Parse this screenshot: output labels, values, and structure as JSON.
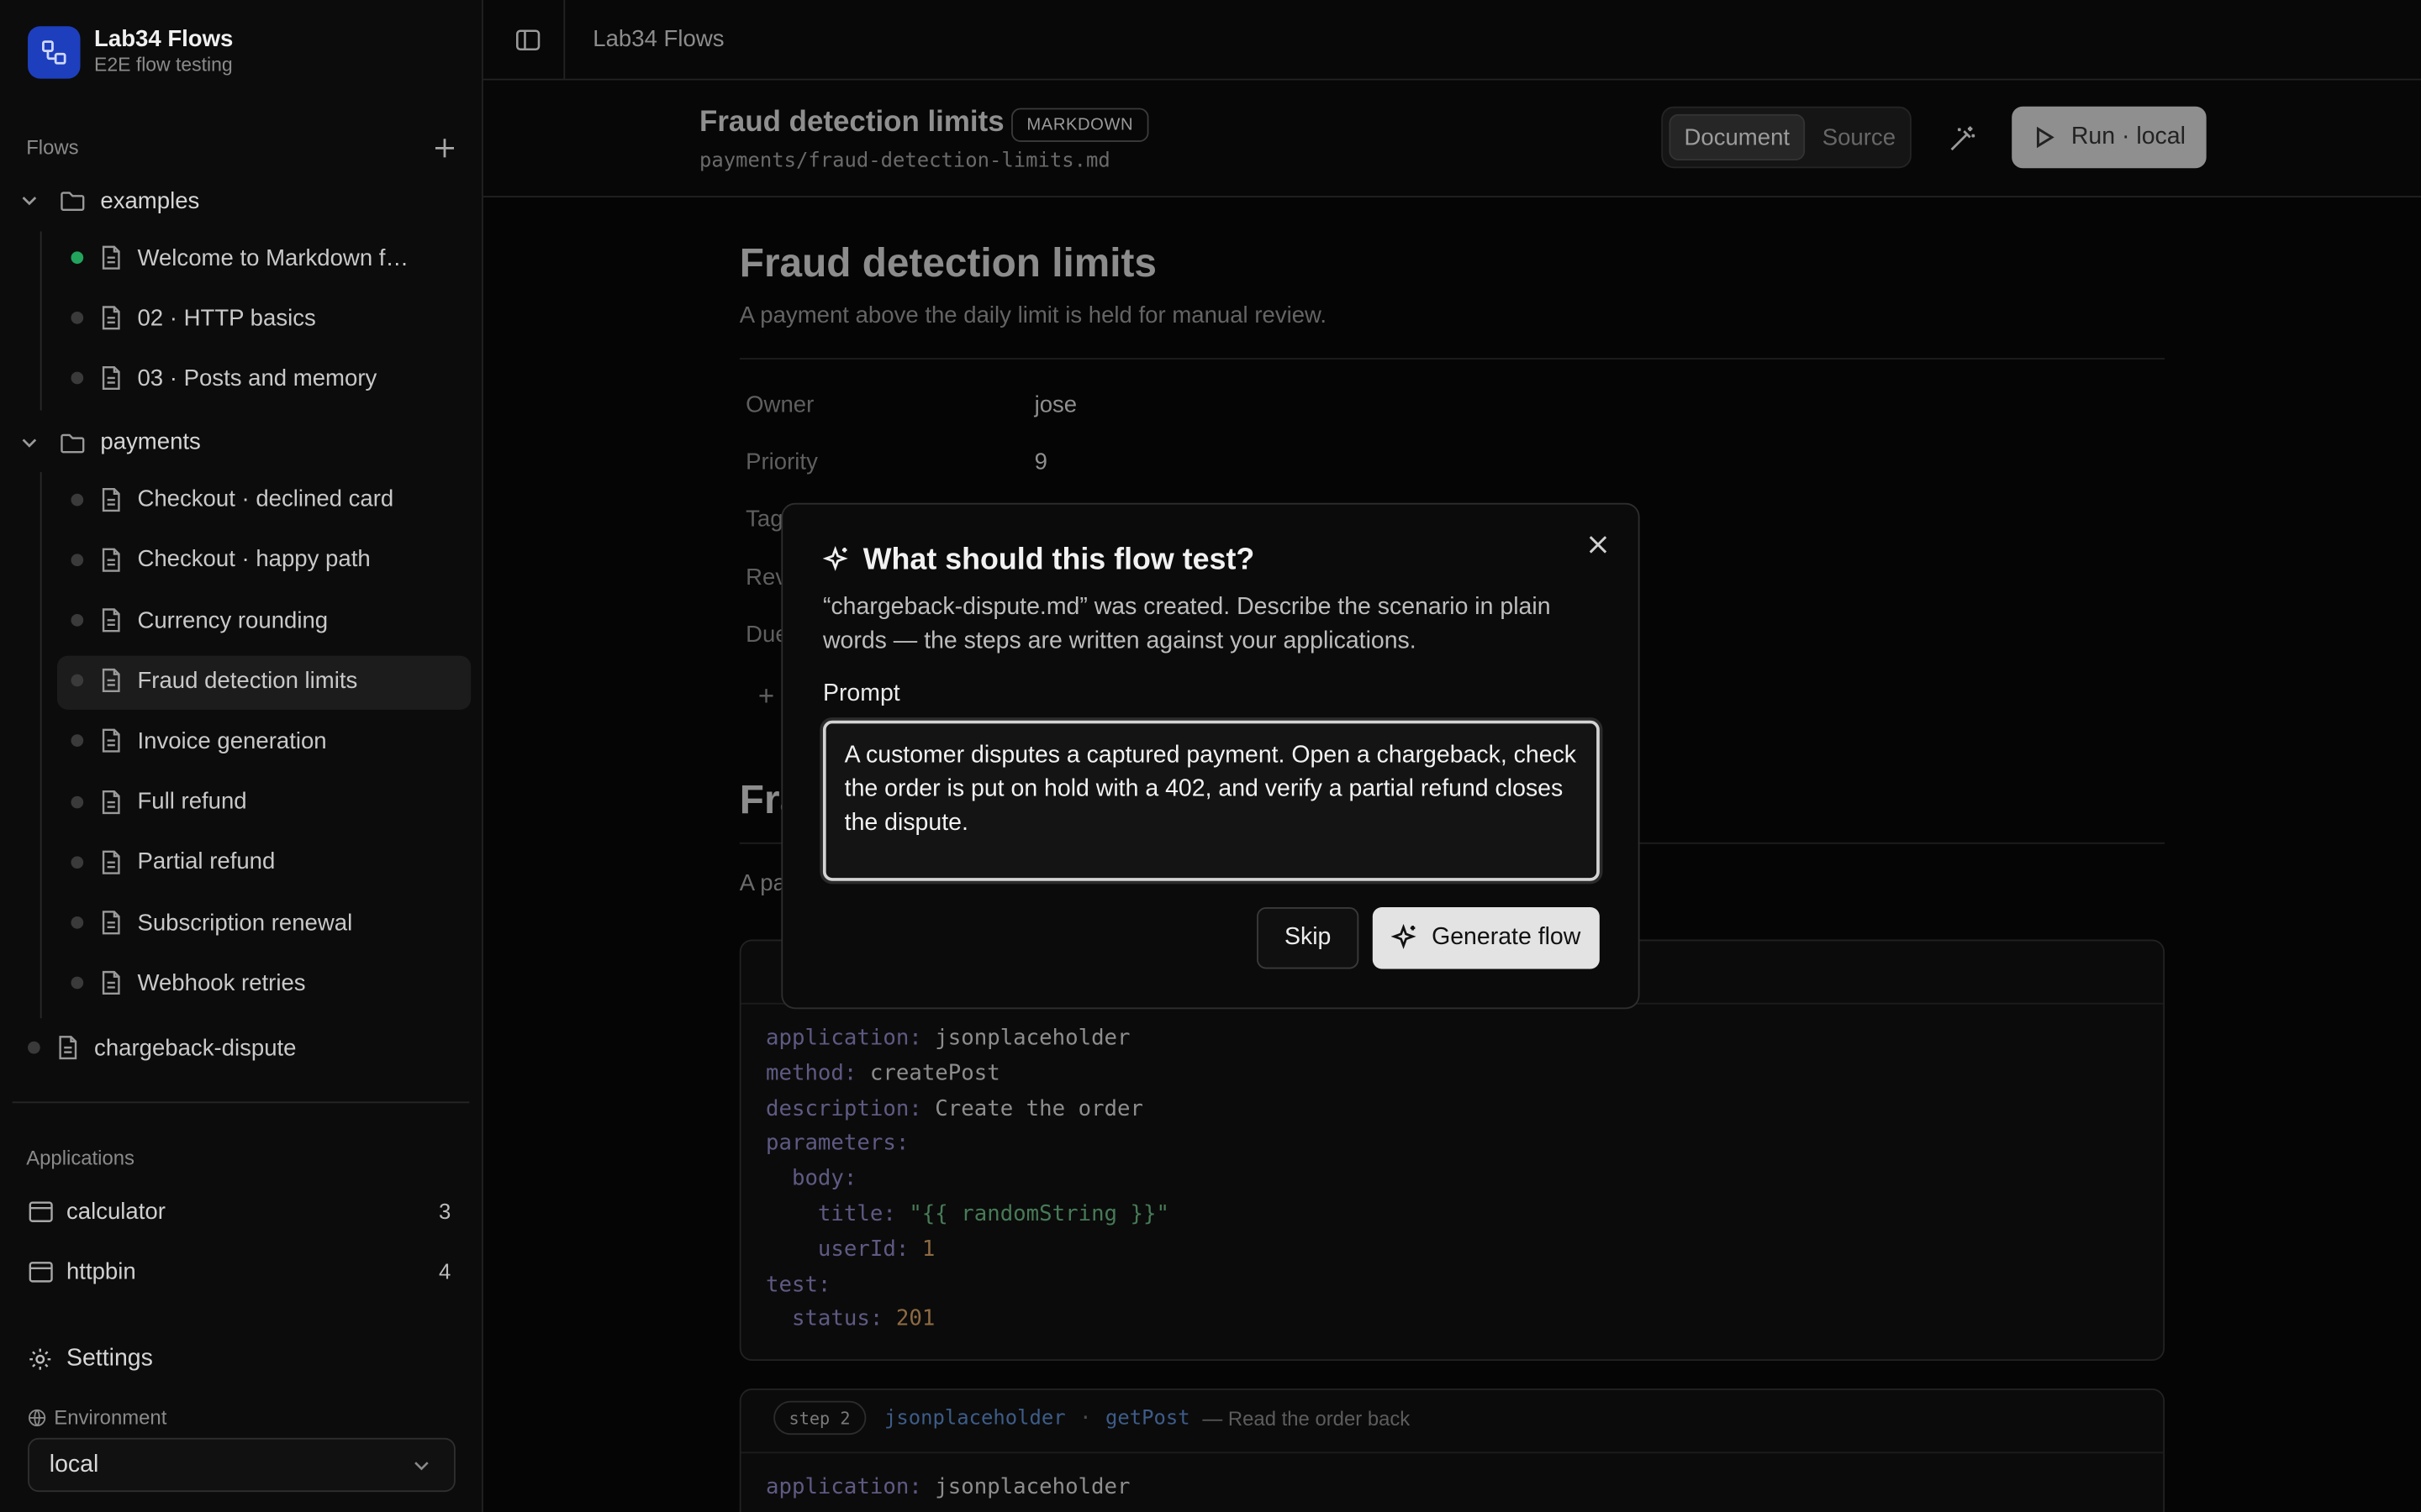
{
  "app": {
    "name": "Lab34 Flows",
    "subtitle": "E2E flow testing"
  },
  "sidebar": {
    "flows_label": "Flows",
    "folders": [
      {
        "name": "examples",
        "items": [
          {
            "label": "Welcome to Markdown f…",
            "status": "passed"
          },
          {
            "label": "02 · HTTP basics",
            "status": "idle"
          },
          {
            "label": "03 · Posts and memory",
            "status": "idle"
          }
        ]
      },
      {
        "name": "payments",
        "items": [
          {
            "label": "Checkout · declined card",
            "status": "idle"
          },
          {
            "label": "Checkout · happy path",
            "status": "idle"
          },
          {
            "label": "Currency rounding",
            "status": "idle"
          },
          {
            "label": "Fraud detection limits",
            "status": "idle",
            "selected": true
          },
          {
            "label": "Invoice generation",
            "status": "idle"
          },
          {
            "label": "Full refund",
            "status": "idle"
          },
          {
            "label": "Partial refund",
            "status": "idle"
          },
          {
            "label": "Subscription renewal",
            "status": "idle"
          },
          {
            "label": "Webhook retries",
            "status": "idle"
          }
        ]
      }
    ],
    "root_items": [
      {
        "label": "chargeback-dispute",
        "status": "idle"
      }
    ],
    "applications_label": "Applications",
    "applications": [
      {
        "name": "calculator",
        "count": "3"
      },
      {
        "name": "httpbin",
        "count": "4"
      }
    ],
    "settings_label": "Settings",
    "environment_label": "Environment",
    "environment_value": "local"
  },
  "topbar": {
    "title": "Lab34 Flows"
  },
  "doc": {
    "title": "Fraud detection limits",
    "badge": "MARKDOWN",
    "path": "payments/fraud-detection-limits.md",
    "view_document": "Document",
    "view_source": "Source",
    "run_label": "Run · local",
    "h1": "Fraud detection limits",
    "lead": "A payment above the daily limit is held for manual review.",
    "props": [
      {
        "key": "Owner",
        "value": "jose"
      },
      {
        "key": "Priority",
        "value": "9"
      },
      {
        "key": "Tag",
        "value": ""
      },
      {
        "key": "Rev",
        "value": ""
      },
      {
        "key": "Due",
        "value": ""
      }
    ],
    "h2": "Fra",
    "para": "A pa",
    "step1_code": [
      {
        "k": "application",
        "v": "jsonplaceholder",
        "t": "str0"
      },
      {
        "k": "method",
        "v": "createPost",
        "t": "str0"
      },
      {
        "k": "description",
        "v": "Create the order",
        "t": "str0"
      },
      {
        "k": "parameters",
        "v": "",
        "t": "key"
      },
      {
        "k": "  body",
        "v": "",
        "t": "key"
      },
      {
        "k": "    title",
        "v": "\"{{ randomString }}\"",
        "t": "str"
      },
      {
        "k": "    userId",
        "v": "1",
        "t": "num"
      },
      {
        "k": "test",
        "v": "",
        "t": "key"
      },
      {
        "k": "  status",
        "v": "201",
        "t": "num"
      }
    ],
    "step2": {
      "badge": "step 2",
      "app": "jsonplaceholder",
      "method": "getPost",
      "desc": "— Read the order back"
    },
    "step2_code_first": {
      "k": "application",
      "v": "jsonplaceholder"
    }
  },
  "modal": {
    "title": "What should this flow test?",
    "description": "“chargeback-dispute.md” was created. Describe the scenario in plain words — the steps are written against your applications.",
    "prompt_label": "Prompt",
    "prompt_value": "A customer disputes a captured payment. Open a chargeback, check the order is put on hold with a 402, and verify a partial refund closes the dispute.",
    "skip_label": "Skip",
    "generate_label": "Generate flow"
  }
}
